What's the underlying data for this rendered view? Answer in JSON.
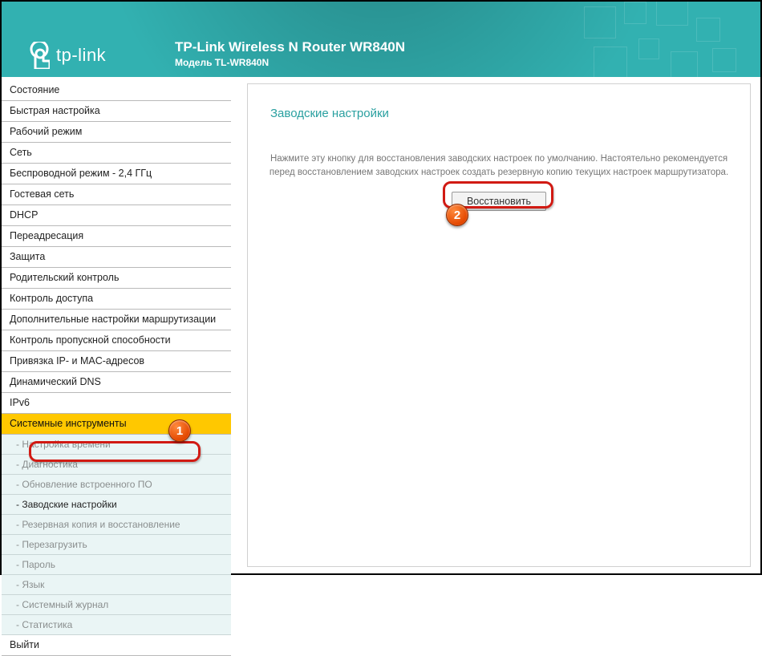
{
  "header": {
    "brand": "tp-link",
    "title": "TP-Link Wireless N Router WR840N",
    "model": "Модель TL-WR840N"
  },
  "sidebar": {
    "items": [
      "Состояние",
      "Быстрая настройка",
      "Рабочий режим",
      "Сеть",
      "Беспроводной режим - 2,4 ГГц",
      "Гостевая сеть",
      "DHCP",
      "Переадресация",
      "Защита",
      "Родительский контроль",
      "Контроль доступа",
      "Дополнительные настройки маршрутизации",
      "Контроль пропускной способности",
      "Привязка IP- и MAC-адресов",
      "Динамический DNS",
      "IPv6"
    ],
    "open_section": "Системные инструменты",
    "sub_items": [
      "- Настройка времени",
      "- Диагностика",
      "- Обновление встроенного ПО",
      "- Заводские настройки",
      "- Резервная копия и восстановление",
      "- Перезагрузить",
      "- Пароль",
      "- Язык",
      "- Системный журнал",
      "- Статистика"
    ],
    "active_sub_index": 3,
    "logout": "Выйти"
  },
  "content": {
    "title": "Заводские настройки",
    "instruction": "Нажмите эту кнопку для восстановления заводских настроек по умолчанию. Настоятельно рекомендуется перед восстановлением заводских настроек создать резервную копию текущих настроек маршрутизатора.",
    "restore_label": "Восстановить"
  },
  "callouts": {
    "b1": "1",
    "b2": "2"
  }
}
